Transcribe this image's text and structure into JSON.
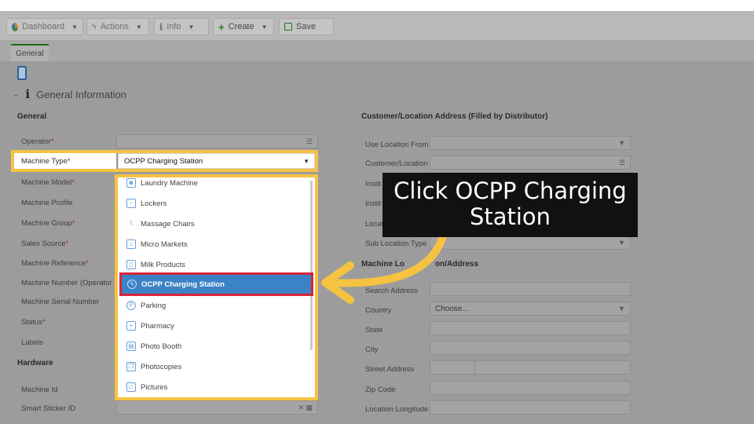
{
  "toolbar": {
    "dashboard": "Dashboard",
    "actions": "Actions",
    "info": "Info",
    "create": "Create",
    "save": "Save"
  },
  "tabs": {
    "general": "General"
  },
  "section": {
    "title": "General Information"
  },
  "left": {
    "heading": "General",
    "fields": [
      {
        "label": "Operator",
        "required": "*"
      },
      {
        "label": "Machine Type",
        "required": "*"
      },
      {
        "label": "Machine Model",
        "required": "*"
      },
      {
        "label": "Machine Profile",
        "required": ""
      },
      {
        "label": "Machine Group",
        "required": "*"
      },
      {
        "label": "Sales Source",
        "required": "*"
      },
      {
        "label": "Machine Reference",
        "required": "*"
      },
      {
        "label": "Machine Number (Operator",
        "required": ""
      },
      {
        "label": "Machine Serial Number",
        "required": ""
      },
      {
        "label": "Status",
        "required": "*"
      },
      {
        "label": "Labels",
        "required": ""
      }
    ],
    "hardware_heading": "Hardware",
    "hardware_fields": [
      {
        "label": "Machine Id"
      },
      {
        "label": "Smart Sticker ID"
      }
    ],
    "machine_type_value": "OCPP Charging Station"
  },
  "dropdown": {
    "items": [
      "Laundry Machine",
      "Lockers",
      "Massage Chairs",
      "Micro Markets",
      "Milk Products",
      "OCPP Charging Station",
      "Parking",
      "Pharmacy",
      "Photo Booth",
      "Photocopies",
      "Pictures"
    ],
    "selected": "OCPP Charging Station"
  },
  "right": {
    "heading": "Customer/Location Address (Filled by Distributor)",
    "fields": [
      {
        "label": "Use Location From"
      },
      {
        "label": "Customer/Location"
      },
      {
        "label": "Instit"
      },
      {
        "label": "Instit"
      },
      {
        "label": "Locat"
      },
      {
        "label": "Sub Location Type"
      }
    ],
    "address_heading_a": "Machine Lo",
    "address_heading_b": "on/Address",
    "address_fields": [
      {
        "label": "Search Address",
        "value": ""
      },
      {
        "label": "Country",
        "value": "Choose..."
      },
      {
        "label": "State",
        "value": ""
      },
      {
        "label": "City",
        "value": ""
      },
      {
        "label": "Street Address",
        "value": ""
      },
      {
        "label": "Zip Code",
        "value": ""
      },
      {
        "label": "Location Longitude",
        "value": ""
      }
    ]
  },
  "callout": {
    "line1": "Click OCPP Charging",
    "line2": "Station"
  },
  "colors": {
    "highlight": "#f5c242",
    "selected_bg": "#3b83c6",
    "selected_border": "#d8253a",
    "callout_bg": "#111111"
  }
}
